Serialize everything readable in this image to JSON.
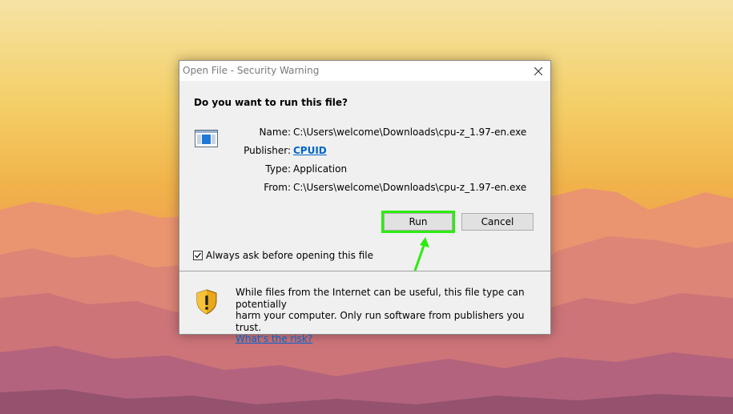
{
  "dialog": {
    "title": "Open File - Security Warning",
    "question": "Do you want to run this file?",
    "fields": {
      "name_label": "Name:",
      "name_value": "C:\\Users\\welcome\\Downloads\\cpu-z_1.97-en.exe",
      "publisher_label": "Publisher:",
      "publisher_value": "CPUID",
      "type_label": "Type:",
      "type_value": "Application",
      "from_label": "From:",
      "from_value": "C:\\Users\\welcome\\Downloads\\cpu-z_1.97-en.exe"
    },
    "buttons": {
      "run": "Run",
      "cancel": "Cancel"
    },
    "checkbox": {
      "label": "Always ask before opening this file",
      "checked": true
    },
    "warning": {
      "line1": "While files from the Internet can be useful, this file type can potentially",
      "line2": "harm your computer. Only run software from publishers you trust.",
      "link": "What's the risk?"
    }
  },
  "colors": {
    "highlight": "#2aed0f",
    "link": "#0066cc"
  },
  "icons": [
    "application-icon",
    "close-icon",
    "shield-warning-icon",
    "checkmark-icon",
    "annotation-arrow"
  ]
}
